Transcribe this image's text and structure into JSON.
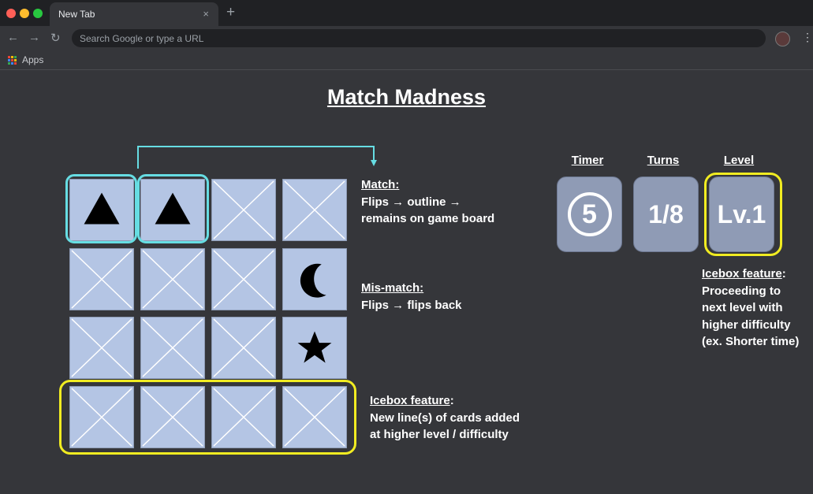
{
  "browser": {
    "tab_title": "New Tab",
    "tab_close": "×",
    "new_tab": "+",
    "back": "←",
    "forward": "→",
    "reload": "↻",
    "omnibox_placeholder": "Search Google or type a URL",
    "menu": "⋮",
    "bookmark_apps": "Apps"
  },
  "page": {
    "title": "Match Madness"
  },
  "board": {
    "rows": [
      [
        "triangle",
        "triangle",
        "blank",
        "blank"
      ],
      [
        "blank",
        "blank",
        "blank",
        "moon"
      ],
      [
        "blank",
        "blank",
        "blank",
        "star"
      ],
      [
        "blank",
        "blank",
        "blank",
        "blank"
      ]
    ]
  },
  "notes": {
    "match": {
      "heading": "Match:",
      "lines": [
        "Flips → outline →",
        "remains on game board"
      ]
    },
    "mismatch": {
      "heading": "Mis-match:",
      "lines": [
        "Flips → flips back"
      ]
    },
    "icebox_board": {
      "heading": "Icebox feature",
      "colon": ":",
      "lines": [
        "New line(s) of cards added",
        "at higher level / difficulty"
      ]
    },
    "icebox_level": {
      "heading": "Icebox feature",
      "colon": ":",
      "lines": [
        "Proceeding to",
        "next level with",
        "higher difficulty",
        "(ex. Shorter time)"
      ]
    }
  },
  "stats": {
    "timer": {
      "label": "Timer",
      "value": "5"
    },
    "turns": {
      "label": "Turns",
      "value": "1/8"
    },
    "level": {
      "label": "Level",
      "value": "Lv.1"
    }
  },
  "colors": {
    "background": "#35363a",
    "card": "#b4c5e4",
    "match_outline": "#66dde3",
    "icebox_outline": "#f1ec21",
    "stat_box": "#8f9bb5"
  }
}
